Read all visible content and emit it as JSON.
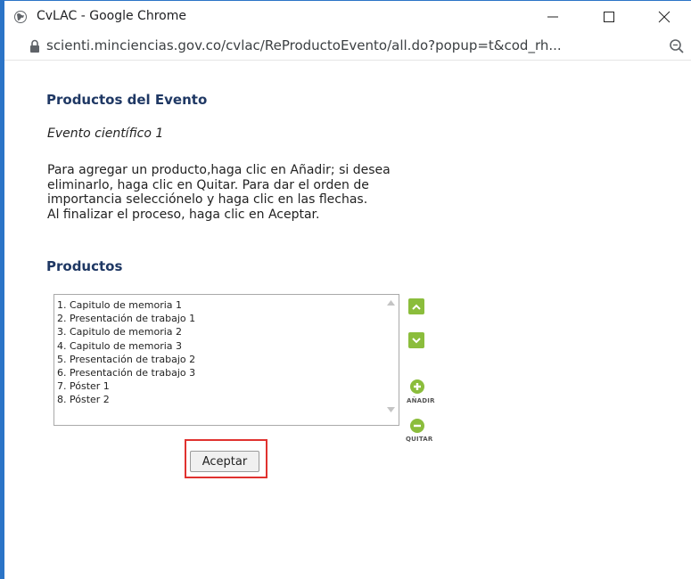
{
  "window": {
    "title": "CvLAC - Google Chrome",
    "url": "scienti.minciencias.gov.co/cvlac/ReProductoEvento/all.do?popup=t&cod_rh..."
  },
  "page": {
    "heading": "Productos del Evento",
    "event_name": "Evento científico 1",
    "instructions": [
      "Para agregar un producto,haga clic en Añadir; si desea",
      "eliminarlo, haga clic en Quitar. Para dar el orden de",
      "importancia selecciónelo y haga clic en las flechas.",
      "Al finalizar el proceso, haga clic en Aceptar."
    ],
    "products_heading": "Productos",
    "products": [
      "1. Capitulo de memoria 1",
      "2. Presentación de trabajo 1",
      "3. Capitulo de memoria 2",
      "4. Capitulo de memoria 3",
      "5. Presentación de trabajo 2",
      "6. Presentación de trabajo 3",
      "7. Póster 1",
      "8. Póster 2"
    ],
    "add_label": "AÑADIR",
    "remove_label": "QUITAR",
    "accept_label": "Aceptar"
  },
  "colors": {
    "window_accent": "#2b74c7",
    "heading": "#1f3864",
    "action_green": "#8bbd3c",
    "highlight_red": "#e0322f"
  }
}
